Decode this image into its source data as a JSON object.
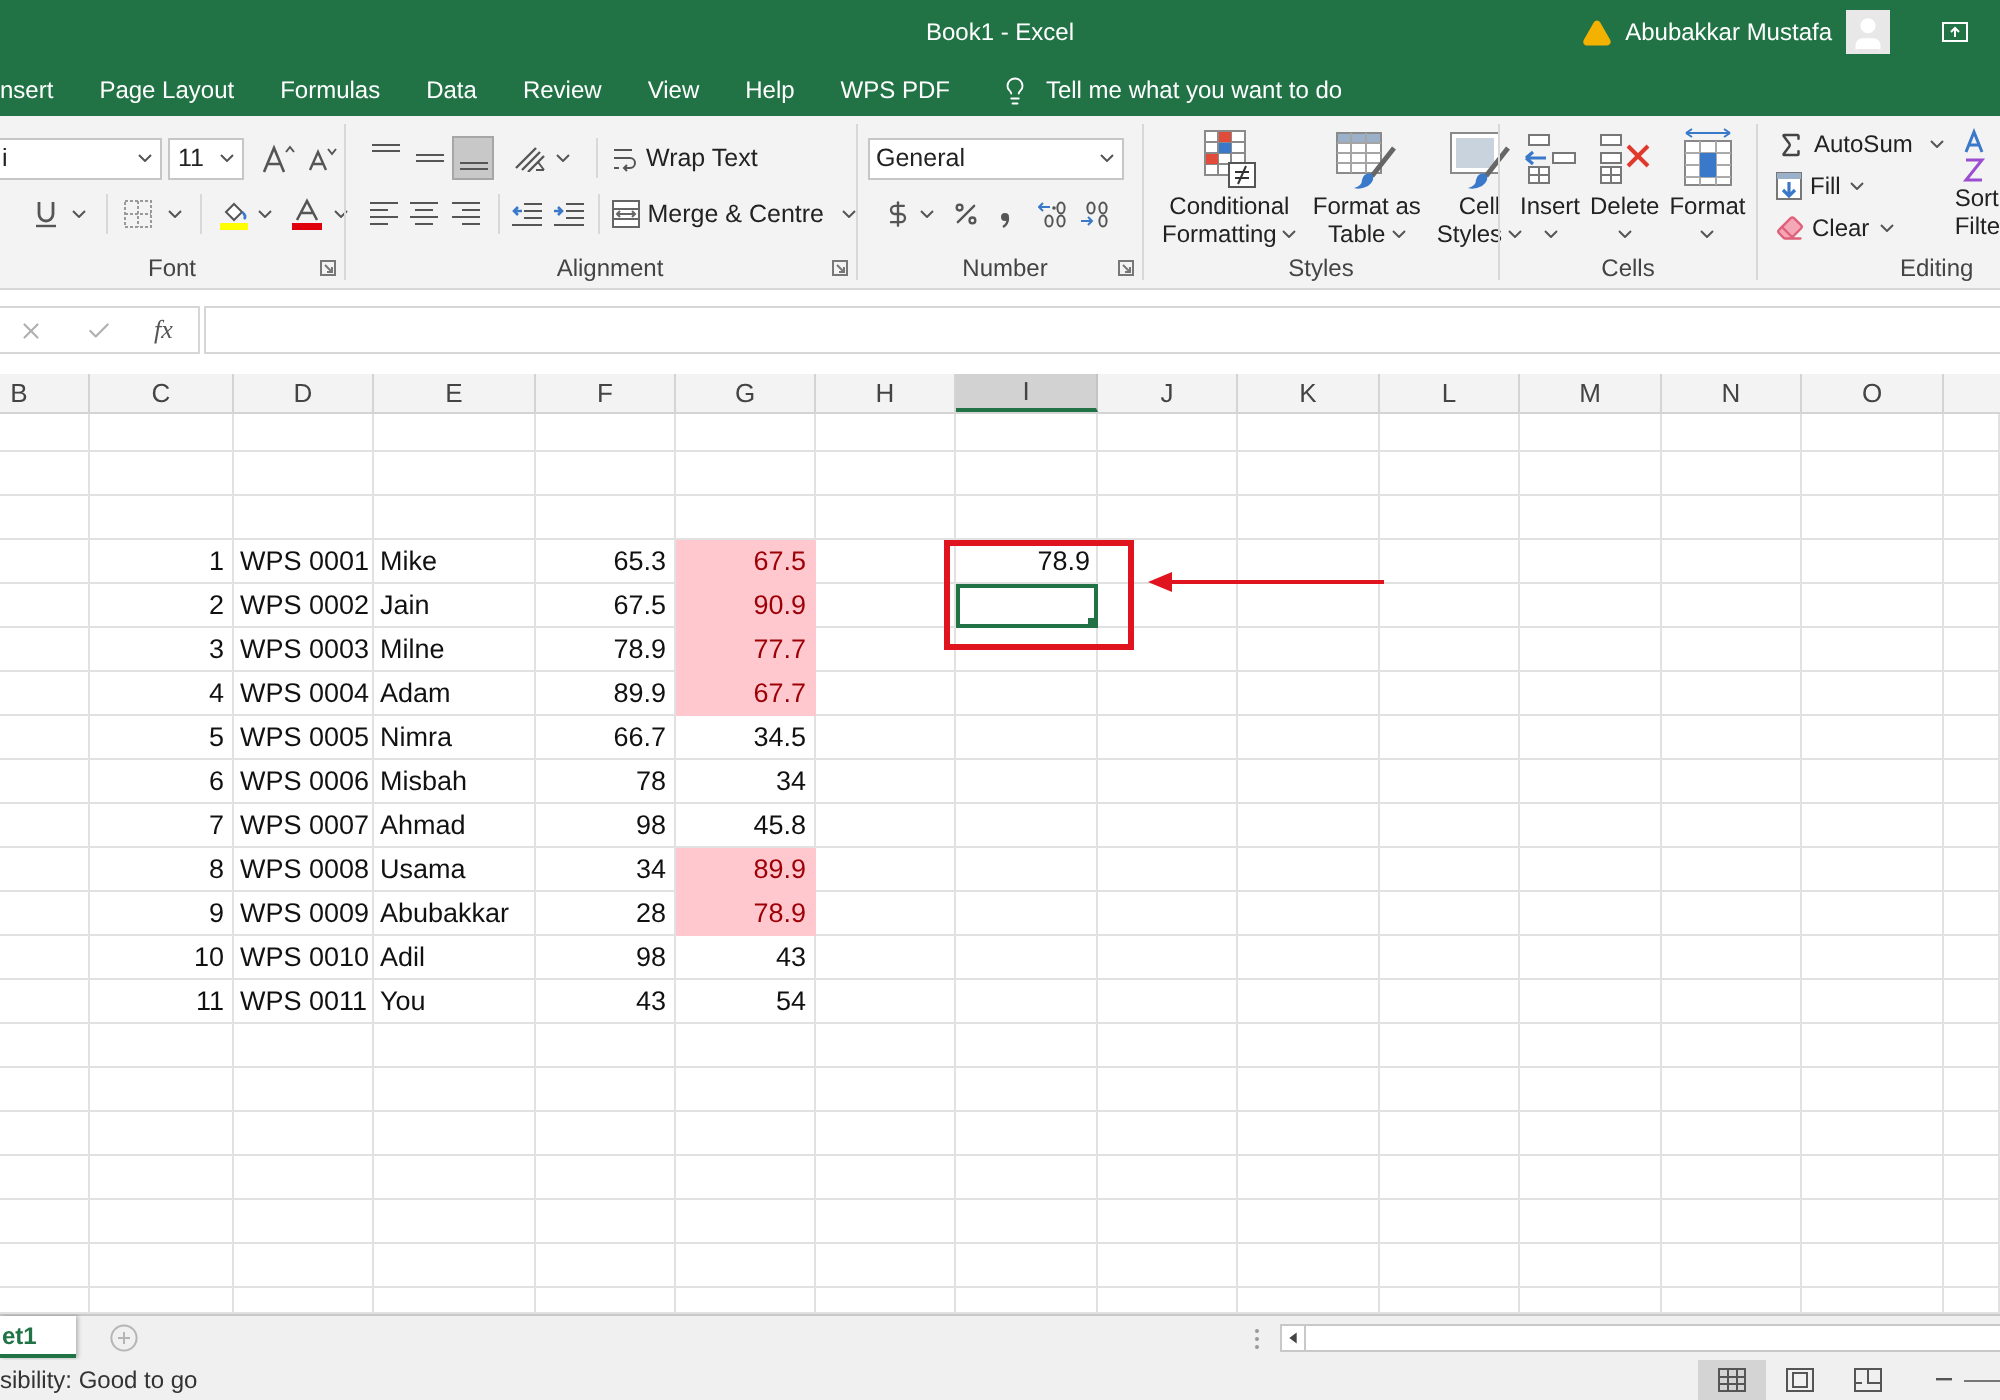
{
  "title_bar": {
    "title": "Book1 - Excel",
    "user": "Abubakkar Mustafa"
  },
  "ribbon_tabs": [
    "nsert",
    "Page Layout",
    "Formulas",
    "Data",
    "Review",
    "View",
    "Help",
    "WPS PDF"
  ],
  "tell_me": {
    "placeholder": "Tell me what you want to do"
  },
  "ribbon": {
    "font": {
      "label": "Font",
      "font_name": "i",
      "font_size": "11"
    },
    "alignment": {
      "label": "Alignment",
      "vertical_align": [
        {
          "kind": "top",
          "selected": false
        },
        {
          "kind": "middle",
          "selected": false
        },
        {
          "kind": "bottom",
          "selected": true
        }
      ],
      "wrap_text": "Wrap Text",
      "merge": "Merge & Centre"
    },
    "number": {
      "label": "Number",
      "format": "General"
    },
    "styles": {
      "label": "Styles",
      "buttons": [
        {
          "kind": "conditional",
          "lines": [
            "Conditional",
            "Formatting"
          ]
        },
        {
          "kind": "table",
          "lines": [
            "Format as",
            "Table"
          ]
        },
        {
          "kind": "cell_styles",
          "lines": [
            "Cell",
            "Styles"
          ]
        }
      ]
    },
    "cells": {
      "label": "Cells",
      "buttons": [
        {
          "kind": "insert",
          "label": "Insert"
        },
        {
          "kind": "delete",
          "label": "Delete"
        },
        {
          "kind": "format",
          "label": "Format"
        }
      ]
    },
    "editing": {
      "label": "Editing",
      "items": [
        {
          "kind": "autosum",
          "label": "AutoSum"
        },
        {
          "kind": "fill",
          "label": "Fill"
        },
        {
          "kind": "clear",
          "label": "Clear"
        }
      ],
      "sort_filter": [
        "Sort",
        "Filte"
      ]
    }
  },
  "formula_bar": {
    "function_label": "fx"
  },
  "sheet": {
    "columns": [
      {
        "label": "B",
        "selected": false
      },
      {
        "label": "C",
        "selected": false
      },
      {
        "label": "D",
        "selected": false
      },
      {
        "label": "E",
        "selected": false
      },
      {
        "label": "F",
        "selected": false
      },
      {
        "label": "G",
        "selected": false
      },
      {
        "label": "H",
        "selected": false
      },
      {
        "label": "I",
        "selected": true
      },
      {
        "label": "J",
        "selected": false
      },
      {
        "label": "K",
        "selected": false
      },
      {
        "label": "L",
        "selected": false
      },
      {
        "label": "M",
        "selected": false
      },
      {
        "label": "N",
        "selected": false
      },
      {
        "label": "O",
        "selected": false
      }
    ],
    "rows": [
      {
        "cells": [
          "",
          "1",
          "WPS 0001",
          "Mike",
          "65.3",
          "67.5",
          "",
          "78.9"
        ],
        "G_highlighted": true,
        "I_selected": false
      },
      {
        "cells": [
          "",
          "2",
          "WPS 0002",
          "Jain",
          "67.5",
          "90.9"
        ],
        "G_highlighted": true,
        "I_selected": true
      },
      {
        "cells": [
          "",
          "3",
          "WPS 0003",
          "Milne",
          "78.9",
          "77.7"
        ],
        "G_highlighted": true,
        "I_selected": false
      },
      {
        "cells": [
          "",
          "4",
          "WPS 0004",
          "Adam",
          "89.9",
          "67.7"
        ],
        "G_highlighted": true,
        "I_selected": false
      },
      {
        "cells": [
          "",
          "5",
          "WPS 0005",
          "Nimra",
          "66.7",
          "34.5"
        ],
        "G_highlighted": false,
        "I_selected": false
      },
      {
        "cells": [
          "",
          "6",
          "WPS 0006",
          "Misbah",
          "78",
          "34"
        ],
        "G_highlighted": false,
        "I_selected": false
      },
      {
        "cells": [
          "",
          "7",
          "WPS 0007",
          "Ahmad",
          "98",
          "45.8"
        ],
        "G_highlighted": false,
        "I_selected": false
      },
      {
        "cells": [
          "",
          "8",
          "WPS 0008",
          "Usama",
          "34",
          "89.9"
        ],
        "G_highlighted": true,
        "I_selected": false
      },
      {
        "cells": [
          "",
          "9",
          "WPS 0009",
          "Abubakkar",
          "28",
          "78.9"
        ],
        "G_highlighted": true,
        "I_selected": false
      },
      {
        "cells": [
          "",
          "10",
          "WPS 0010",
          "Adil",
          "98",
          "43"
        ],
        "G_highlighted": false,
        "I_selected": false
      },
      {
        "cells": [
          "",
          "11",
          "WPS 0011",
          "You",
          "43",
          "54"
        ],
        "G_highlighted": false,
        "I_selected": false
      }
    ]
  },
  "sheet_tabs": [
    {
      "label": "et1",
      "selected": true
    }
  ],
  "status_bar": {
    "text": "sibility: Good to go",
    "views": [
      {
        "kind": "normal",
        "selected": true
      },
      {
        "kind": "page_layout",
        "selected": false
      },
      {
        "kind": "page_break",
        "selected": false
      }
    ]
  }
}
